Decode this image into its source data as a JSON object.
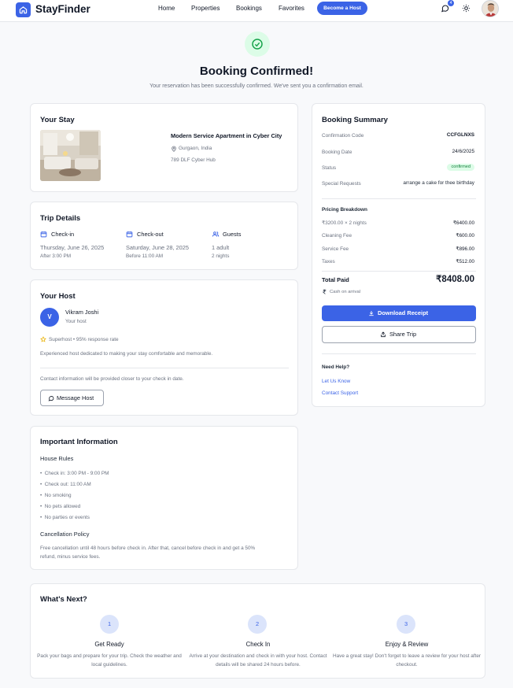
{
  "brand": {
    "name": "StayFinder"
  },
  "nav": {
    "home": "Home",
    "properties": "Properties",
    "bookings": "Bookings",
    "favorites": "Favorites",
    "become_host": "Become a Host",
    "notification_count": "4"
  },
  "hero": {
    "title": "Booking Confirmed!",
    "subtitle": "Your reservation has been successfully confirmed. We've sent you a confirmation email."
  },
  "stay": {
    "heading": "Your Stay",
    "property_name": "Modern Service Apartment in Cyber City",
    "location": "Gurgaon, India",
    "address": "789 DLF Cyber Hub"
  },
  "trip": {
    "heading": "Trip Details",
    "checkin_label": "Check-in",
    "checkin_date": "Thursday, June 26, 2025",
    "checkin_time": "After 3:00 PM",
    "checkout_label": "Check-out",
    "checkout_date": "Saturday, June 28, 2025",
    "checkout_time": "Before 11:00 AM",
    "guests_label": "Guests",
    "guests_count": "1 adult",
    "nights": "2 nights"
  },
  "host": {
    "heading": "Your Host",
    "initial": "V",
    "name": "Vikram Joshi",
    "role": "Your host",
    "superhost": "Superhost • 95% response rate",
    "bio": "Experienced host dedicated to making your stay comfortable and memorable.",
    "contact_note": "Contact information will be provided closer to your check in date.",
    "message_button": "Message Host"
  },
  "info": {
    "heading": "Important Information",
    "rules_heading": "House Rules",
    "rules": [
      "Check in: 3:00 PM - 9:00 PM",
      "Check out: 11:00 AM",
      "No smoking",
      "No pets allowed",
      "No parties or events"
    ],
    "policy_heading": "Cancellation Policy",
    "policy_line1": "Free cancellation until 48 hours before check in. After that, cancel before check in and get a 50%",
    "policy_line2": "refund, minus service fees."
  },
  "summary": {
    "heading": "Booking Summary",
    "code_label": "Confirmation Code",
    "code_value": "CCFGLNXS",
    "date_label": "Booking Date",
    "date_value": "24/6/2025",
    "status_label": "Status",
    "status_value": "confirmed",
    "requests_label": "Special Requests",
    "requests_value": "arrange a cake for thee birthday",
    "pricing_heading": "Pricing Breakdown",
    "lines": [
      {
        "label": "₹3200.00 × 2 nights",
        "value": "₹6400.00"
      },
      {
        "label": "Cleaning Fee",
        "value": "₹600.00"
      },
      {
        "label": "Service Fee",
        "value": "₹896.00"
      },
      {
        "label": "Taxes",
        "value": "₹512.00"
      }
    ],
    "total_label": "Total Paid",
    "total_value": "₹8408.00",
    "payment_method": "Cash on arrival",
    "download_button": "Download Receipt",
    "share_button": "Share Trip",
    "help_heading": "Need Help?",
    "help_link1": "Let Us Know",
    "help_link2": "Contact Support"
  },
  "next": {
    "heading": "What's Next?",
    "steps": [
      {
        "num": "1",
        "title": "Get Ready",
        "desc": "Pack your bags and prepare for your trip. Check the weather and local guidelines."
      },
      {
        "num": "2",
        "title": "Check In",
        "desc": "Arrive at your destination and check in with your host. Contact details will be shared 24 hours before."
      },
      {
        "num": "3",
        "title": "Enjoy & Review",
        "desc": "Have a great stay! Don't forget to leave a review for your host after checkout."
      }
    ]
  },
  "colors": {
    "accent": "#3b63e6",
    "success_bg": "#dcfce7",
    "success": "#16a34a"
  }
}
